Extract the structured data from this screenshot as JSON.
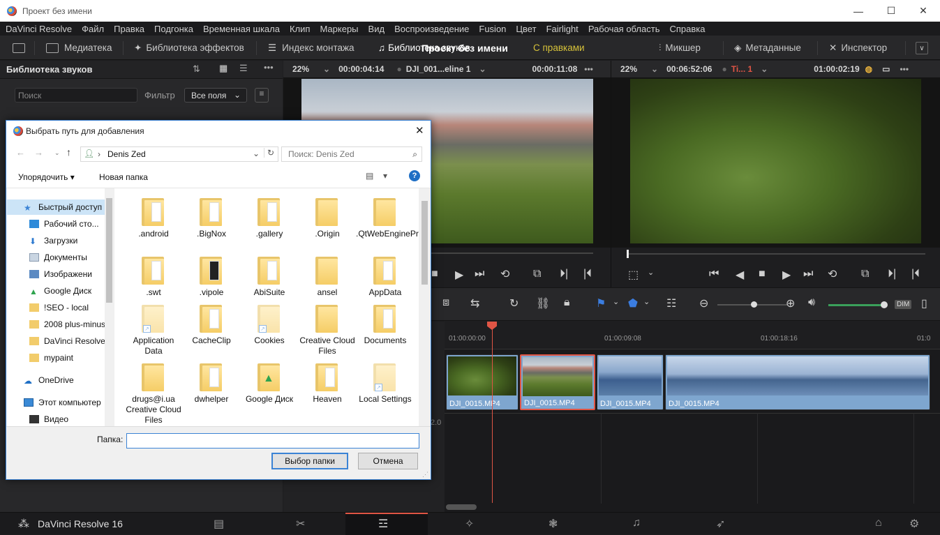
{
  "window": {
    "title": "Проект без имени",
    "minimize": "—",
    "maximize": "☐",
    "close": "✕"
  },
  "menu": [
    "DaVinci Resolve",
    "Файл",
    "Правка",
    "Подгонка",
    "Временная шкала",
    "Клип",
    "Маркеры",
    "Вид",
    "Воспроизведение",
    "Fusion",
    "Цвет",
    "Fairlight",
    "Рабочая область",
    "Справка"
  ],
  "toolbar": {
    "media": "Медиатека",
    "effects": "Библиотека эффектов",
    "edit_index": "Индекс монтажа",
    "sound_library": "Библиотека звуков",
    "project_name": "Проект без имени",
    "edited": "С правками",
    "mixer": "Микшер",
    "metadata": "Метаданные",
    "inspector": "Инспектор"
  },
  "left_panel": {
    "title": "Библиотека звуков",
    "search_placeholder": "Поиск",
    "filter_label": "Фильтр",
    "filter_value": "Все поля"
  },
  "source_viewer": {
    "zoom": "22%",
    "timecode": "00:00:04:14",
    "clip": "DJI_001...eline 1",
    "duration": "00:00:11:08"
  },
  "timeline_viewer": {
    "zoom": "22%",
    "timecode": "00:06:52:06",
    "timeline": "Ti... 1",
    "position": "01:00:02:19"
  },
  "timeline": {
    "ticks": [
      "01:00:00:00",
      "01:00:09:08",
      "01:00:18:16",
      "01:0"
    ],
    "clips": [
      "DJI_0015.MP4",
      "DJI_0015.MP4",
      "DJI_0015.MP4",
      "DJI_0015.MP4"
    ],
    "track_number": "2.0",
    "dim": "DIM"
  },
  "bottom": {
    "app_name": "DaVinci Resolve 16"
  },
  "dialog": {
    "title": "Выбрать путь для добавления",
    "path": "Denis Zed",
    "search_placeholder": "Поиск: Denis Zed",
    "organize": "Упорядочить ▾",
    "new_folder": "Новая папка",
    "nav": [
      "Быстрый доступ",
      "Рабочий сто...",
      "Загрузки",
      "Документы",
      "Изображени",
      "Google Диск",
      "!SEO - local",
      "2008 plus-minus",
      "DaVinci Resolve",
      "mypaint",
      "OneDrive",
      "Этот компьютер",
      "Видео"
    ],
    "files": [
      ".android",
      ".BigNox",
      ".gallery",
      ".Origin",
      ".QtWebEngineProcess",
      ".swt",
      ".vipole",
      "AbiSuite",
      "ansel",
      "AppData",
      "Application Data",
      "CacheClip",
      "Cookies",
      "Creative Cloud Files",
      "Documents",
      "drugs@i.ua Creative Cloud Files",
      "dwhelper",
      "Google Диск",
      "Heaven",
      "Local Settings"
    ],
    "folder_label": "Папка:",
    "folder_value": "",
    "select_button": "Выбор папки",
    "cancel_button": "Отмена"
  }
}
